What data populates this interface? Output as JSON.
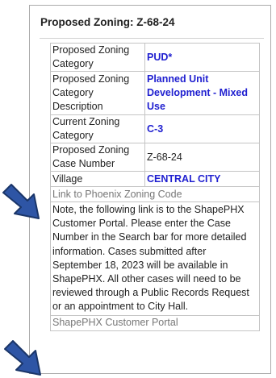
{
  "popup": {
    "title": "Proposed Zoning: Z-68-24"
  },
  "rows": [
    {
      "label": "Proposed Zoning Category",
      "value": "PUD*"
    },
    {
      "label": "Proposed Zoning Category Description",
      "value": "Planned Unit Development - Mixed Use"
    },
    {
      "label": "Current Zoning Category",
      "value": "C-3"
    },
    {
      "label": "Proposed Zoning Case Number",
      "value": "Z-68-24"
    },
    {
      "label": "Village",
      "value": "CENTRAL CITY"
    }
  ],
  "links": {
    "zoning_code": "Link to Phoenix Zoning Code",
    "customer_portal": "ShapePHX Customer Portal"
  },
  "note": "Note, the following link is to the ShapePHX Customer Portal. Please enter the Case Number in the Search bar for more detailed information. Cases submitted after September 18, 2023 will be available in ShapePHX. All other cases will need to be reviewed through a Public Records Request or an appointment to City Hall.",
  "colors": {
    "value_text": "#2020d0",
    "arrow_fill": "#2e55a5",
    "arrow_stroke": "#1a3568",
    "link_text": "#777777"
  },
  "icons": {
    "arrow_1": "pointing-arrow-icon",
    "arrow_2": "pointing-arrow-icon"
  }
}
